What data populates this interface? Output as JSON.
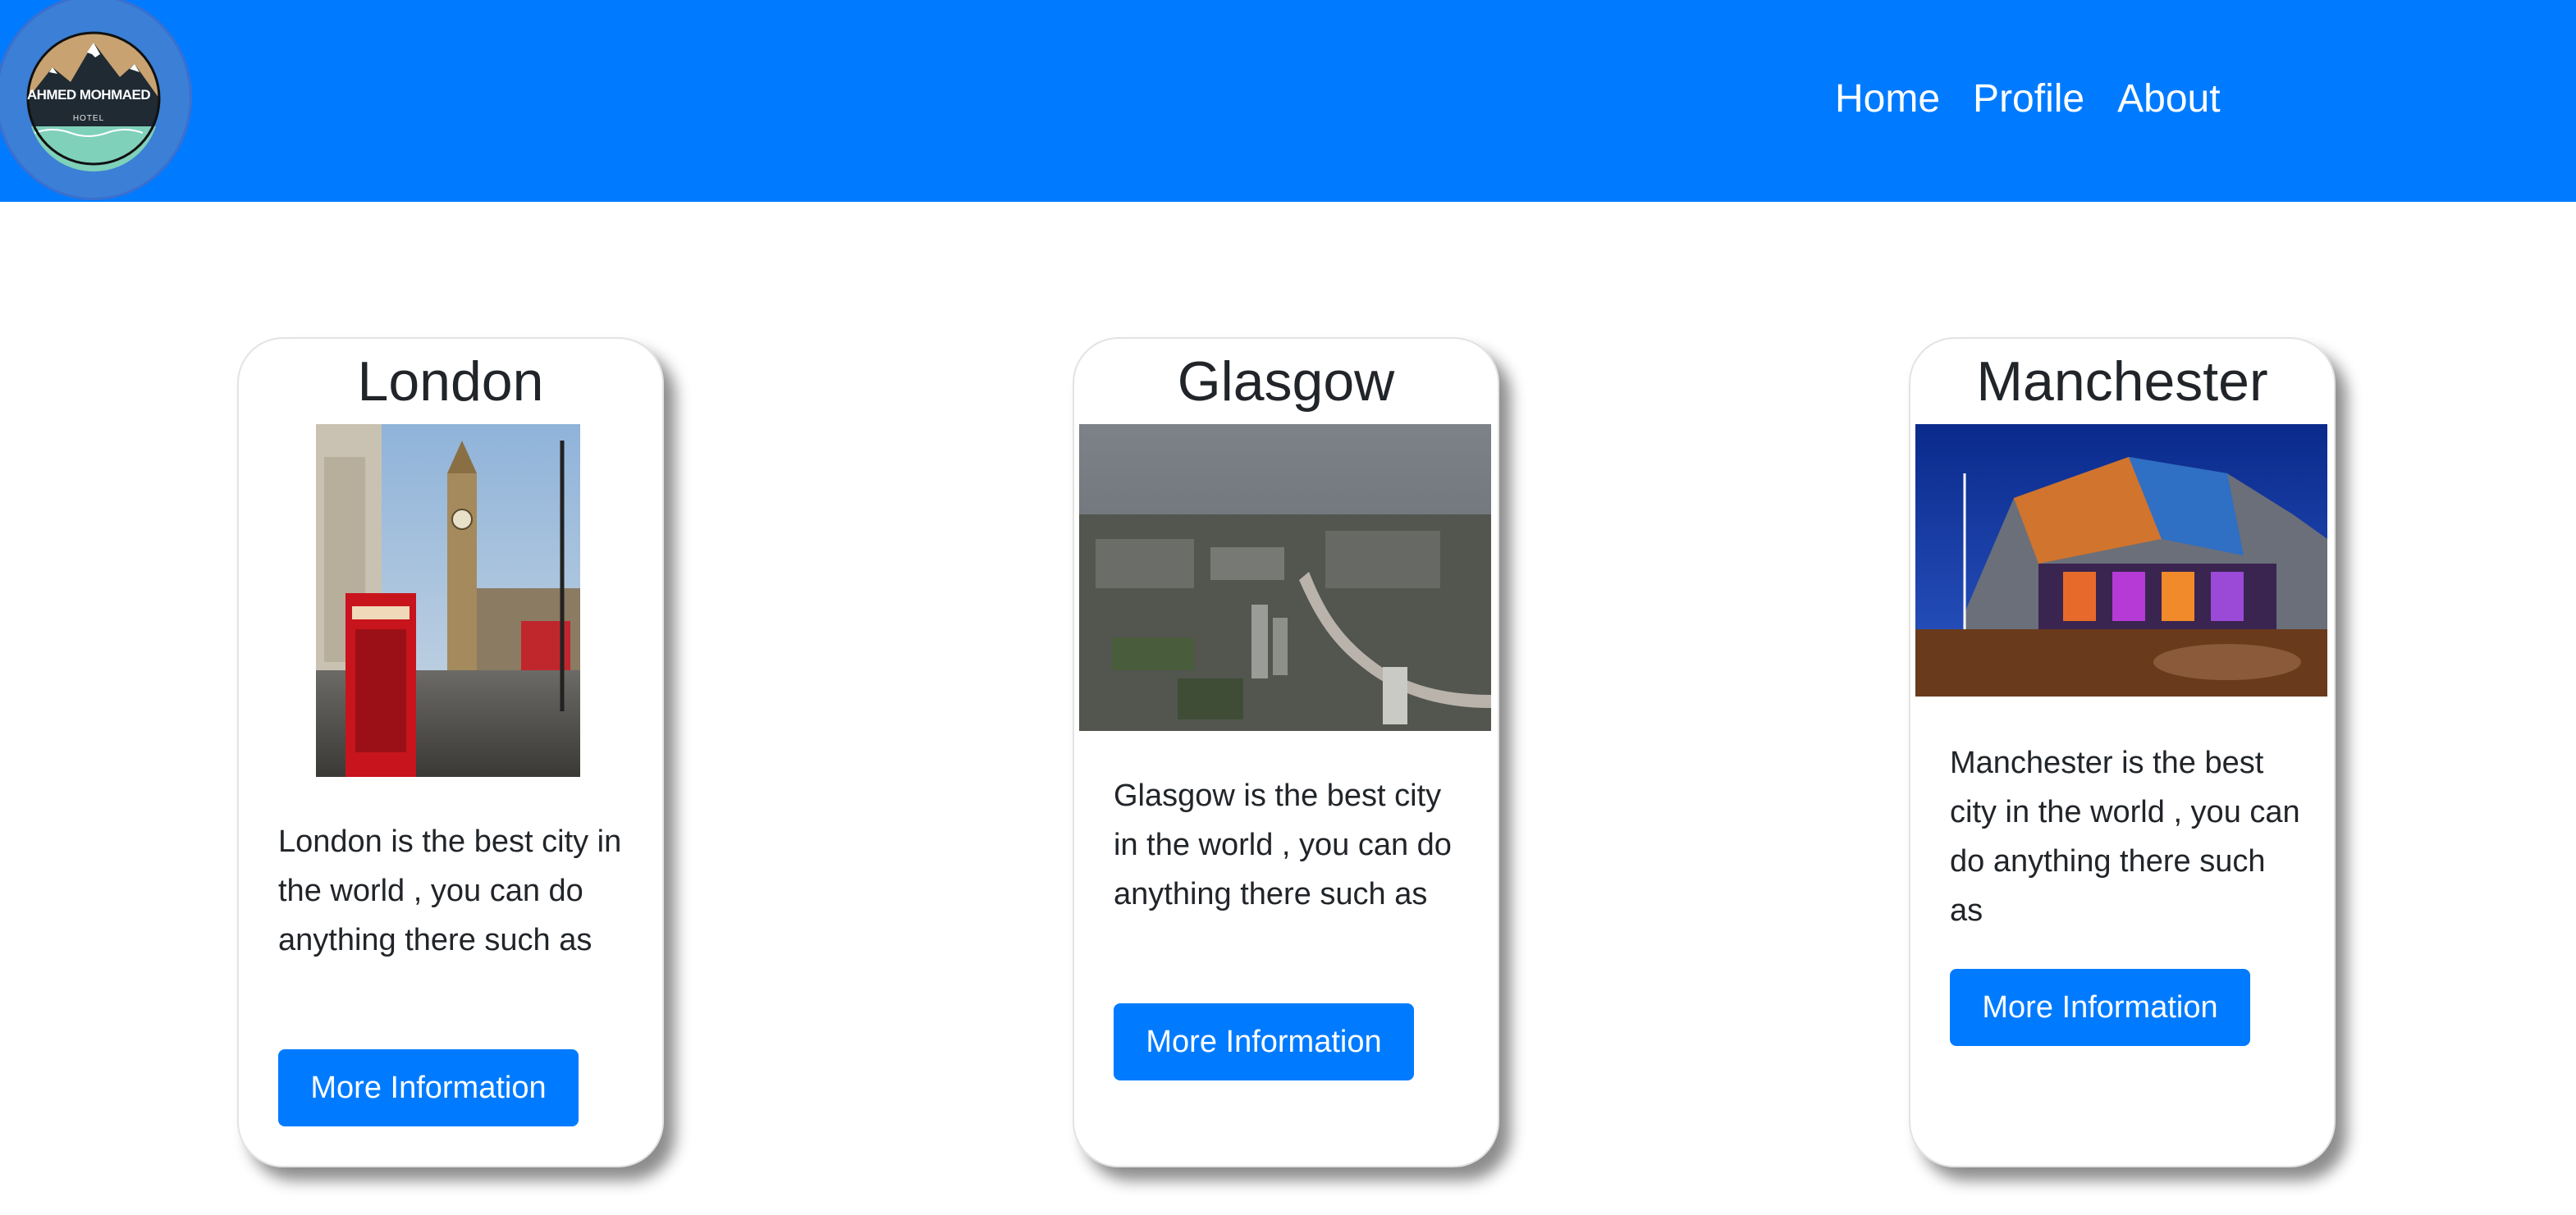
{
  "brand": {
    "logo_title": "AHMED MOHMAED",
    "logo_subtitle": "HOTEL"
  },
  "nav": {
    "items": [
      {
        "label": "Home"
      },
      {
        "label": "Profile"
      },
      {
        "label": "About"
      }
    ]
  },
  "cards": [
    {
      "title": "London",
      "text": "London is the best city in the world , you can do anything there such as",
      "button": "More Information",
      "image": "london-telephone-box-big-ben-photo"
    },
    {
      "title": "Glasgow",
      "text": "Glasgow is the best city in the world , you can do anything there such as",
      "button": "More Information",
      "image": "glasgow-aerial-river-photo"
    },
    {
      "title": "Manchester",
      "text": "Manchester is the best city in the world , you can do anything there such as",
      "button": "More Information",
      "image": "manchester-lowry-building-night-photo"
    }
  ],
  "colors": {
    "navbar": "#007bff",
    "button": "#007bff",
    "text": "#212529"
  }
}
